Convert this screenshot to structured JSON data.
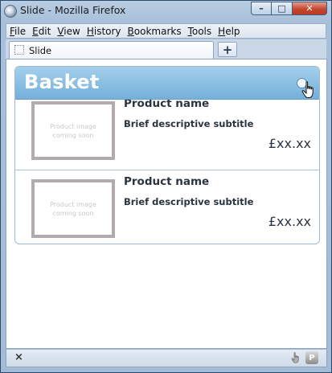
{
  "window": {
    "title": "Slide - Mozilla Firefox",
    "minimize_glyph": "–",
    "maximize_glyph": "□",
    "close_glyph": "✕"
  },
  "menubar": {
    "items": [
      "File",
      "Edit",
      "View",
      "History",
      "Bookmarks",
      "Tools",
      "Help"
    ]
  },
  "tabs": {
    "active_label": "Slide",
    "new_tab_glyph": "+"
  },
  "basket": {
    "title": "Basket",
    "items": [
      {
        "image_line1": "Product image",
        "image_line2": "coming soon",
        "name": "Product name",
        "subtitle": "Brief descriptive subtitle",
        "price": "£xx.xx"
      },
      {
        "image_line1": "Product image",
        "image_line2": "coming soon",
        "name": "Product name",
        "subtitle": "Brief descriptive subtitle",
        "price": "£xx.xx"
      }
    ]
  },
  "statusbar": {
    "close_glyph": "×",
    "addon_glyph": "P"
  },
  "icons": {
    "browser": "firefox-icon",
    "page": "blank-page-icon",
    "cursor": "hand-pointer-icon",
    "addon": "addon-p-icon"
  }
}
